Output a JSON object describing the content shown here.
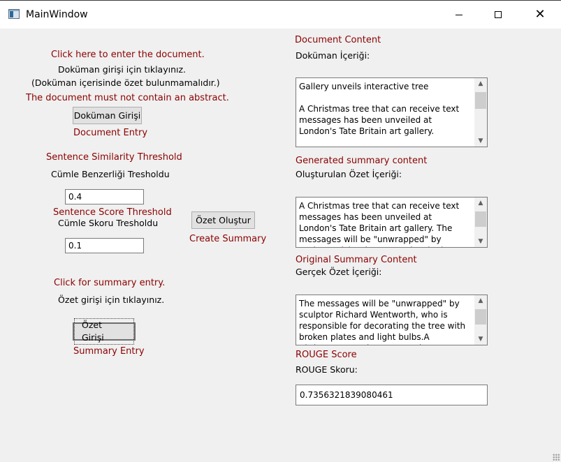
{
  "window": {
    "title": "MainWindow"
  },
  "left": {
    "doc_prompt_en": "Click here to enter the document.",
    "doc_prompt_tr": "Doküman girişi için tıklayınız.",
    "doc_note_tr": "(Doküman içerisinde özet bulunmamalıdır.)",
    "doc_note_en": "The document must not contain an abstract.",
    "doc_button": "Doküman Girişi",
    "doc_entry_en": "Document Entry",
    "sim_threshold_en": "Sentence Similarity Threshold",
    "sim_threshold_tr": "Cümle Benzerliği Tresholdu",
    "sim_value": "0.4",
    "score_threshold_en": "Sentence Score Threshold",
    "score_threshold_tr": "Cümle Skoru Tresholdu",
    "score_value": "0.1",
    "summary_prompt_en": "Click for summary entry.",
    "summary_prompt_tr": "Özet girişi için tıklayınız.",
    "summary_button": "Özet Girişi",
    "summary_entry_en": "Summary Entry"
  },
  "middle": {
    "create_button": "Özet Oluştur",
    "create_label_en": "Create Summary"
  },
  "right": {
    "doc_content_en": "Document Content",
    "doc_content_tr": "Doküman İçeriği:",
    "doc_content_text": "Gallery unveils interactive tree\n\nA Christmas tree that can receive text messages has been unveiled at London's Tate Britain art gallery.",
    "gen_summary_en": "Generated summary content",
    "gen_summary_tr": "Oluşturulan Özet İçeriği:",
    "gen_summary_text": "A Christmas tree that can receive text messages has been unveiled at London's Tate Britain art gallery. The messages will be \"unwrapped\" by sculptor Richard Wentworth, who is responsible for",
    "orig_summary_en": "Original Summary Content",
    "orig_summary_tr": "Gerçek Özet İçeriği:",
    "orig_summary_text": "The messages will be \"unwrapped\" by sculptor Richard Wentworth, who is responsible for decorating the tree with broken plates and light bulbs.A Christmas tree that can receive text messages",
    "rouge_en": "ROUGE Score",
    "rouge_tr": "ROUGE Skoru:",
    "rouge_value": "0.7356321839080461"
  }
}
